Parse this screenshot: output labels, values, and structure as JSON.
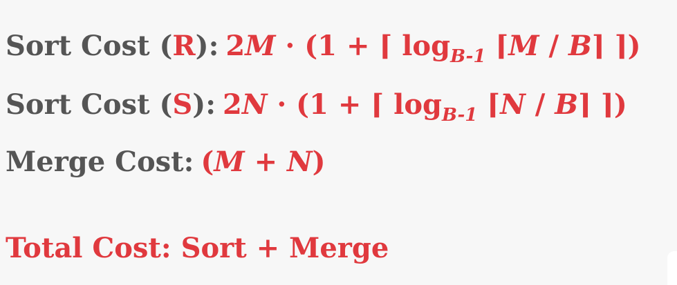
{
  "sort_r": {
    "label": "Sort Cost (",
    "rel": "R",
    "close": "):",
    "coef": "2",
    "var": "M",
    "mid": " · (1 + ⌈ log",
    "base": "B-1",
    "open2": " ⌈",
    "n": "M",
    "div": " / ",
    "b": "B",
    "end": "⌉ ⌉)"
  },
  "sort_s": {
    "label": "Sort Cost (",
    "rel": "S",
    "close": "):",
    "coef": "2",
    "var": "N",
    "mid": " · (1 + ⌈ log",
    "base": "B-1",
    "open2": " ⌈",
    "n": "N",
    "div": " / ",
    "b": "B",
    "end": "⌉ ⌉)"
  },
  "merge": {
    "label": "Merge Cost:",
    "open": "(",
    "m": "M",
    "plus": " + ",
    "n": "N",
    "close": ")"
  },
  "total": {
    "label": "Total Cost: Sort + Merge"
  },
  "colors": {
    "accent": "#e0393e",
    "text": "#555555",
    "background": "#f7f7f7"
  }
}
